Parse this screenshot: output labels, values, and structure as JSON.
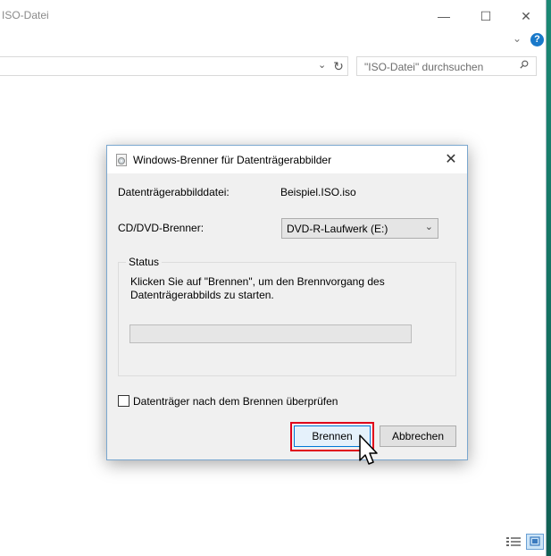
{
  "explorer": {
    "title": "ISO-Datei",
    "search_placeholder": "\"ISO-Datei\" durchsuchen",
    "window_buttons": {
      "minimize": "—",
      "maximize": "☐",
      "close": "✕"
    },
    "help_label": "?",
    "ribbon_toggle": "⌄",
    "address_dropdown": "⌄",
    "refresh_glyph": "↻"
  },
  "dialog": {
    "title": "Windows-Brenner für Datenträgerabbilder",
    "close_glyph": "✕",
    "file_label": "Datenträgerabbilddatei:",
    "file_value": "Beispiel.ISO.iso",
    "burner_label": "CD/DVD-Brenner:",
    "burner_value": "DVD-R-Laufwerk (E:)",
    "burner_arrow": "⌄",
    "status_legend": "Status",
    "status_message": "Klicken Sie auf \"Brennen\", um den Brennvorgang des Datenträgerabbilds zu starten.",
    "progress": 0,
    "verify_label": "Datenträger nach dem Brennen überprüfen",
    "verify_checked": false,
    "burn_button": "Brennen",
    "cancel_button": "Abbrechen"
  },
  "colors": {
    "accent": "#0078d7",
    "highlight": "#e0001b",
    "desktop": "#1c8d77"
  },
  "icons": [
    "disc-burner-icon",
    "search-icon",
    "refresh-icon",
    "help-icon",
    "close-icon",
    "chevron-down-icon",
    "details-view-icon",
    "large-icons-view-icon",
    "mouse-pointer-icon"
  ]
}
